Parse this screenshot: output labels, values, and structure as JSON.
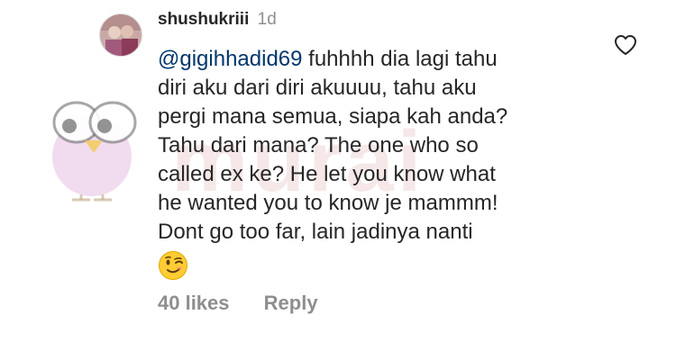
{
  "comment": {
    "username": "shushukriii",
    "time_ago": "1d",
    "mention": "@gigihhadid69",
    "text_lines": [
      " fuhhhh dia lagi tahu",
      "diri aku dari diri akuuuu, tahu aku",
      "pergi mana semua, siapa kah anda?",
      "Tahu dari mana? The one who so",
      "called ex ke? He let you know what",
      "he wanted you to know je mammm!",
      "Dont go too far, lain jadinya nanti"
    ],
    "emoji": "winking-face",
    "likes": "40 likes",
    "reply_label": "Reply"
  },
  "watermark": {
    "text": "murai"
  },
  "colors": {
    "text": "#262626",
    "muted": "#8e8e8e",
    "mention": "#00376b",
    "watermark": "#ebcdcd"
  }
}
